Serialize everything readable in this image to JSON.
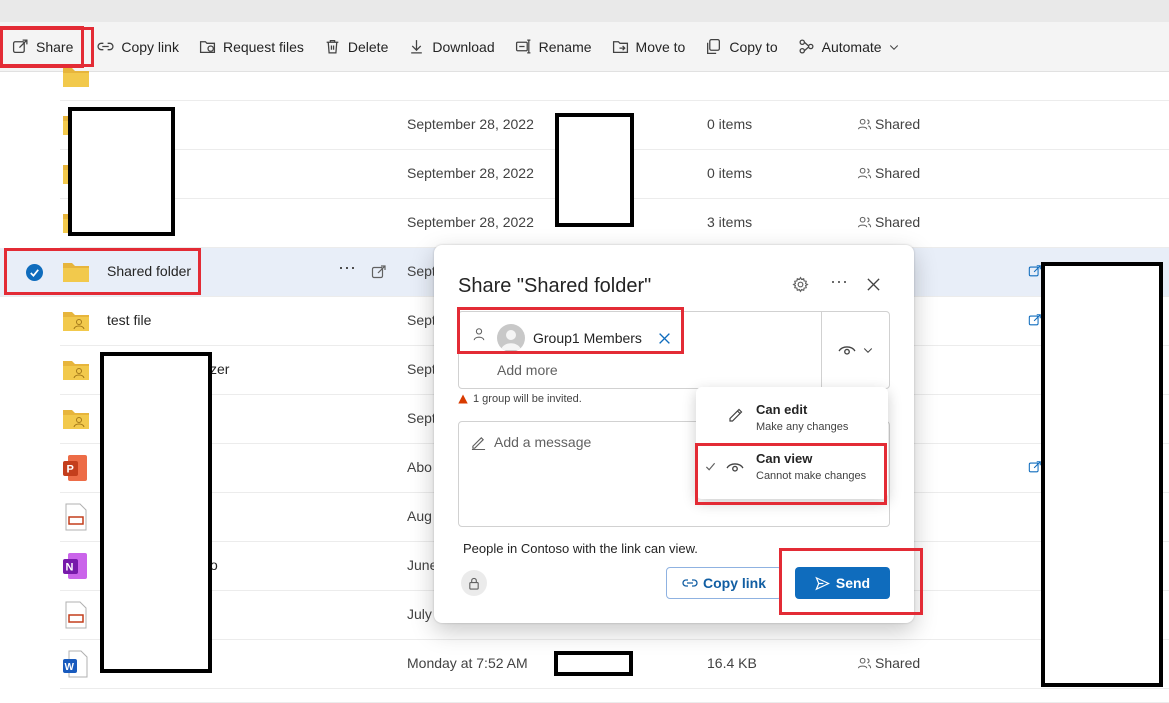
{
  "toolbar": {
    "share": "Share",
    "copy_link": "Copy link",
    "request_files": "Request files",
    "delete": "Delete",
    "download": "Download",
    "rename": "Rename",
    "move_to": "Move to",
    "copy_to": "Copy to",
    "automate": "Automate"
  },
  "rows": [
    {
      "name": "",
      "date": "September 28, 2022",
      "size": "0 items",
      "sharing": "Shared"
    },
    {
      "name": "",
      "date": "September 28, 2022",
      "size": "0 items",
      "sharing": "Shared"
    },
    {
      "name": "",
      "date": "September 28, 2022",
      "size": "3 items",
      "sharing": "Shared"
    },
    {
      "name": "Shared folder",
      "date": "Sept"
    },
    {
      "name": "test file",
      "date": "Sept"
    },
    {
      "name": "zer",
      "date": "Sept"
    },
    {
      "name": "",
      "date": "Sept"
    },
    {
      "name": "",
      "date": "Abo"
    },
    {
      "name": "",
      "date": "Aug"
    },
    {
      "name": "o",
      "date": "June"
    },
    {
      "name": "",
      "date": "July"
    },
    {
      "name": "",
      "date": "Monday at 7:52 AM",
      "size": "16.4 KB",
      "sharing": "Shared"
    }
  ],
  "dialog": {
    "title": "Share \"Shared folder\"",
    "recipient": "Group1 Members",
    "add_more": "Add more",
    "warning": "1 group will be invited.",
    "message_placeholder": "Add a message",
    "link_info": "People in Contoso with the link can view.",
    "copy_link": "Copy link",
    "send": "Send"
  },
  "permission_menu": {
    "items": [
      {
        "title": "Can edit",
        "subtitle": "Make any changes",
        "selected": false
      },
      {
        "title": "Can view",
        "subtitle": "Cannot make changes",
        "selected": true
      }
    ]
  },
  "colors": {
    "accent": "#0f6cbd",
    "highlight": "#e32b35",
    "selected_row": "#e8eef8",
    "folder": "#f2c94c"
  }
}
